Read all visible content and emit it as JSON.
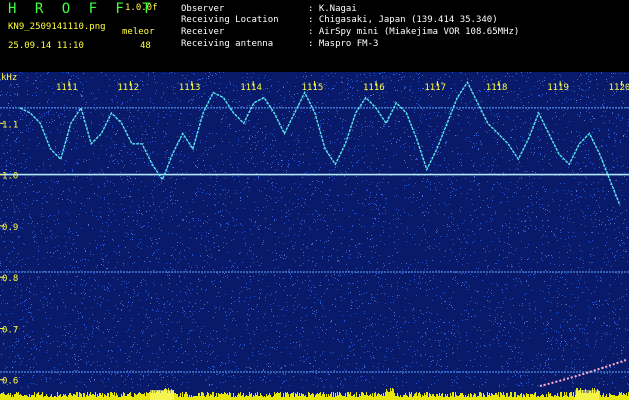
{
  "header": {
    "app_title": "H R O F F T",
    "version": "1.0.0f",
    "filename": "KN9_2509141110.png",
    "datetime": "25.09.14 11:10",
    "meleor_label": "meleor",
    "meleor_count": "48"
  },
  "meta": {
    "observer_label": "Observer",
    "observer_value": ": K.Nagai",
    "location_label": "Receiving Location",
    "location_value": ": Chigasaki, Japan (139.414 35.340)",
    "receiver_label": "Receiver",
    "receiver_value": ": AirSpy mini (Miakejima VOR 108.65MHz)",
    "antenna_label": "Receiving antenna",
    "antenna_value": ": Maspro FM-3"
  },
  "colors": {
    "background": "#0a1a6a",
    "noise": "#2a6aff",
    "trace": "#60ffff",
    "labels": "#ffff40",
    "title": "#40ff40",
    "bottom_bar": "#ffff00"
  },
  "chart_data": {
    "type": "spectrogram",
    "unit_label": "kHz",
    "x_ticks": [
      "1111",
      "1112",
      "1113",
      "1114",
      "1115",
      "1116",
      "1117",
      "1118",
      "1119",
      "1120"
    ],
    "y_ticks": [
      "1.1",
      "1.0",
      "0.9",
      "0.8",
      "0.7",
      "0.6"
    ],
    "ylim": [
      0.58,
      1.2
    ],
    "horizontal_lines_khz": [
      1.13,
      1.0,
      0.81,
      0.615
    ],
    "trace_khz": [
      1.13,
      1.12,
      1.1,
      1.05,
      1.03,
      1.1,
      1.13,
      1.06,
      1.08,
      1.12,
      1.1,
      1.06,
      1.06,
      1.02,
      0.99,
      1.04,
      1.08,
      1.05,
      1.12,
      1.16,
      1.15,
      1.12,
      1.1,
      1.14,
      1.15,
      1.12,
      1.08,
      1.12,
      1.16,
      1.12,
      1.05,
      1.02,
      1.06,
      1.12,
      1.15,
      1.13,
      1.1,
      1.14,
      1.12,
      1.07,
      1.01,
      1.05,
      1.1,
      1.15,
      1.18,
      1.14,
      1.1,
      1.08,
      1.06,
      1.03,
      1.07,
      1.12,
      1.08,
      1.04,
      1.02,
      1.06,
      1.08,
      1.04,
      0.99,
      0.94
    ]
  }
}
